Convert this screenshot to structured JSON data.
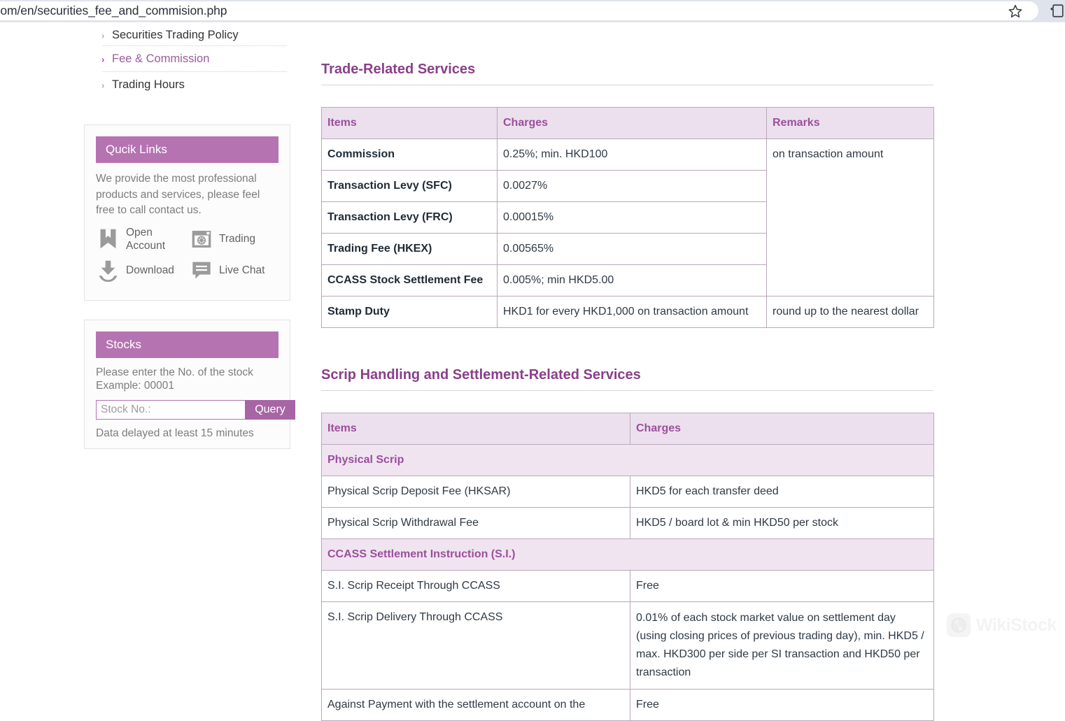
{
  "browser": {
    "url": "sec.com/en/securities_fee_and_commision.php",
    "bookmark_icon": "star-icon",
    "share_icon": "share-install-icon"
  },
  "sidebar": {
    "nav": [
      {
        "label": "Securities Trading Policy",
        "active": false
      },
      {
        "label": "Fee & Commission",
        "active": true
      },
      {
        "label": "Trading Hours",
        "active": false
      }
    ],
    "quick_links": {
      "title": "Qucik Links",
      "description": "We provide the most professional products and services, please feel free to call contact us.",
      "items": [
        {
          "label": "Open Account",
          "icon": "bookmark-icon"
        },
        {
          "label": "Trading",
          "icon": "trading-terminal-icon"
        },
        {
          "label": "Download",
          "icon": "download-icon"
        },
        {
          "label": "Live Chat",
          "icon": "chat-bubble-icon"
        }
      ]
    },
    "stocks": {
      "title": "Stocks",
      "hint_line1": "Please enter the No. of the stock",
      "hint_line2": "Example: 00001",
      "input_placeholder": "Stock No.:",
      "input_value": "",
      "query_label": "Query",
      "note": "Data delayed at least 15 minutes"
    }
  },
  "main": {
    "sections": [
      {
        "title": "Trade-Related Services",
        "columns": [
          "Items",
          "Charges",
          "Remarks"
        ],
        "rows": [
          {
            "item": "Commission",
            "charge": "0.25%; min. HKD100",
            "remark": "on transaction amount",
            "remark_rowspan": 5,
            "bold_item": true
          },
          {
            "item": "Transaction Levy (SFC)",
            "charge": "0.0027%",
            "bold_item": true
          },
          {
            "item": "Transaction Levy (FRC)",
            "charge": "0.00015%",
            "bold_item": true
          },
          {
            "item": "Trading Fee (HKEX)",
            "charge": "0.00565%",
            "bold_item": true
          },
          {
            "item": "CCASS Stock Settlement Fee",
            "charge": "0.005%; min HKD5.00",
            "bold_item": true
          },
          {
            "item": "Stamp Duty",
            "charge": "HKD1 for every HKD1,000 on transaction amount",
            "remark": "round up to the nearest dollar",
            "remark_rowspan": 1,
            "bold_item": true
          }
        ]
      },
      {
        "title": "Scrip Handling and Settlement-Related Services",
        "columns": [
          "Items",
          "Charges"
        ],
        "rows": [
          {
            "subheader": "Physical Scrip"
          },
          {
            "item": "Physical Scrip Deposit Fee (HKSAR)",
            "charge": "HKD5 for each transfer deed"
          },
          {
            "item": "Physical Scrip Withdrawal Fee",
            "charge": "HKD5 / board lot & min HKD50 per stock"
          },
          {
            "subheader": "CCASS Settlement Instruction (S.I.)"
          },
          {
            "item": "S.I. Scrip Receipt Through CCASS",
            "charge": "Free"
          },
          {
            "item": "S.I. Scrip Delivery Through CCASS",
            "charge": "0.01% of each stock market value on settlement day (using closing prices of previous trading day), min. HKD5 / max. HKD300 per side per SI transaction and HKD50 per transaction"
          },
          {
            "item": "Against Payment with the settlement account on the",
            "charge": "Free"
          }
        ]
      }
    ]
  },
  "watermark": {
    "text": "WikiStock"
  },
  "colors": {
    "accent_purple": "#b573b2",
    "title_purple": "#8a3f8a",
    "table_header_bg": "#ece0ee",
    "table_header_text": "#9b4f9b",
    "chrome_bg": "#dfe3ec"
  }
}
